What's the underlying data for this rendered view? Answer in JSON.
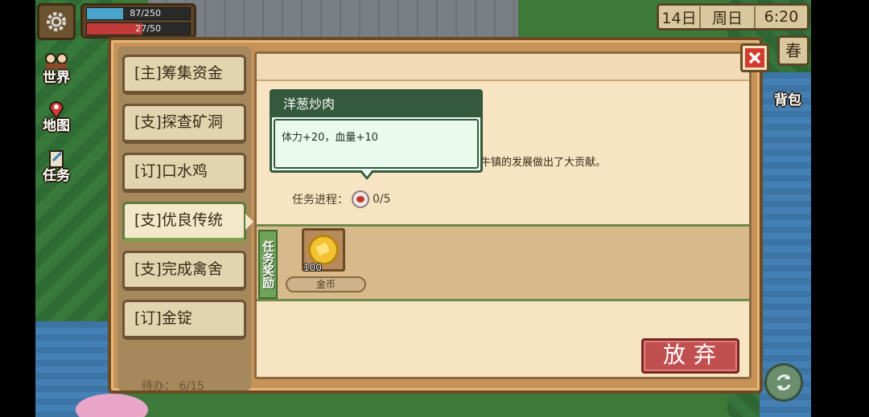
{
  "hud": {
    "stamina_text": "87/250",
    "stamina_ratio": 0.348,
    "health_text": "27/50",
    "health_ratio": 0.54,
    "day": "14日",
    "weekday": "周日",
    "time": "6:20",
    "season": "春"
  },
  "side_menu": {
    "world": "世界",
    "map": "地图",
    "tasks": "任务",
    "backpack": "背包"
  },
  "quest_tabs": [
    {
      "label": "[主]筹集资金"
    },
    {
      "label": "[支]探查矿洞"
    },
    {
      "label": "[订]口水鸡"
    },
    {
      "label": "[支]优良传统"
    },
    {
      "label": "[支]完成禽舍"
    },
    {
      "label": "[订]金锭"
    }
  ],
  "todo": "待办：  6/15",
  "detail": {
    "description_tail": "牛镇的发展做出了大贡献。",
    "progress_label": "任务进程：",
    "progress_value": "0/5",
    "reward_label": "任务奖励",
    "reward_item_name": "金币",
    "reward_count": "100",
    "abandon_label": "放弃"
  },
  "tooltip": {
    "title": "洋葱炒肉",
    "body": "体力+20，血量+10"
  },
  "colors": {
    "panel_bg": "#f7e4c3",
    "frame_brown": "#6b4a24",
    "tooltip_green": "#35593d",
    "abandon_red": "#c0504f"
  },
  "icons": [
    "gear-icon",
    "world-icon",
    "map-pin-icon",
    "quest-icon",
    "backpack-icon",
    "close-icon",
    "refresh-icon",
    "gold-coin-icon",
    "dish-icon"
  ]
}
